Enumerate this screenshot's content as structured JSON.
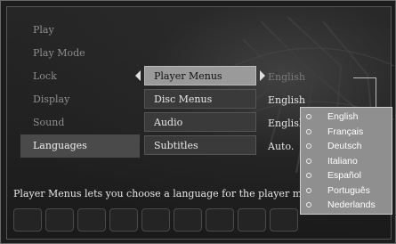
{
  "left_menu": {
    "items": [
      {
        "label": "Play",
        "active": false
      },
      {
        "label": "Play Mode",
        "active": false
      },
      {
        "label": "Lock",
        "active": false
      },
      {
        "label": "Display",
        "active": false
      },
      {
        "label": "Sound",
        "active": false
      },
      {
        "label": "Languages",
        "active": true
      }
    ]
  },
  "submenu": {
    "items": [
      {
        "label": "Player Menus",
        "selected": true
      },
      {
        "label": "Disc Menus",
        "selected": false
      },
      {
        "label": "Audio",
        "selected": false
      },
      {
        "label": "Subtitles",
        "selected": false
      }
    ]
  },
  "values": [
    "English",
    "English",
    "English",
    "Auto."
  ],
  "dropdown": {
    "options": [
      "English",
      "Français",
      "Deutsch",
      "Italiano",
      "Español",
      "Português",
      "Nederlands"
    ],
    "selected": "English"
  },
  "description": "Player Menus lets you choose a language for the player menu"
}
